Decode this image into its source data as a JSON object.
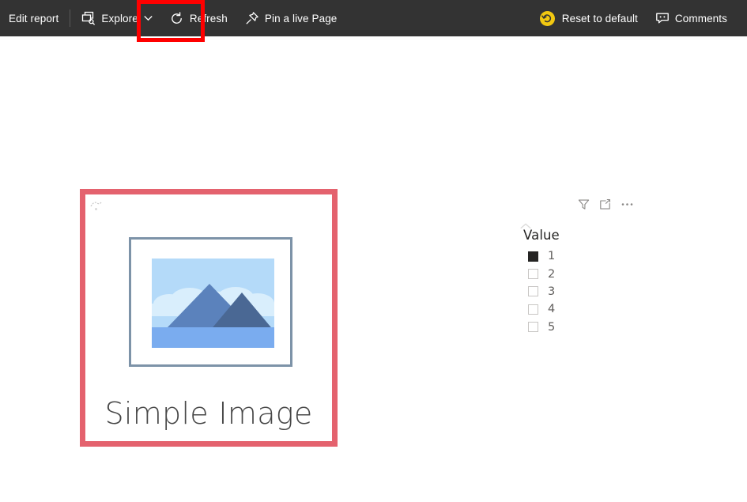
{
  "toolbar": {
    "background_color": "#333333",
    "left_items": [
      {
        "id": "edit-report",
        "label": "Edit report",
        "icon": "none"
      },
      {
        "id": "explore",
        "label": "Explore",
        "icon": "explore-icon",
        "has_chevron": true
      },
      {
        "id": "refresh",
        "label": "Refresh",
        "icon": "refresh-icon",
        "highlighted": true
      },
      {
        "id": "pin-live-page",
        "label": "Pin a live Page",
        "icon": "pin-icon"
      }
    ],
    "right_items": [
      {
        "id": "reset-to-default",
        "label": "Reset to default",
        "icon": "reset-icon",
        "icon_color": "#f2c811"
      },
      {
        "id": "comments",
        "label": "Comments",
        "icon": "comment-icon"
      }
    ]
  },
  "annotation": {
    "target": "Refresh",
    "color": "#ff0000",
    "shape": "rectangle"
  },
  "canvas": {
    "image_visual": {
      "caption": "Simple Image",
      "selected": true,
      "selection_color": "#e4626e",
      "picture": {
        "alt": "mountain-landscape",
        "frame_color": "#7d93a8",
        "sky_color": "#b4daf9",
        "cloud_color": "#d9eefc",
        "mountain_left_color": "#5b82bc",
        "mountain_right_color": "#4a6894",
        "water_color": "#7aacef"
      }
    },
    "slicer_visual": {
      "title": "Value",
      "header_icons": [
        {
          "id": "filter",
          "name": "filter-icon"
        },
        {
          "id": "focus-mode",
          "name": "focus-mode-icon"
        },
        {
          "id": "more-options",
          "name": "more-options-icon"
        }
      ],
      "items": [
        {
          "label": "1",
          "checked": true
        },
        {
          "label": "2",
          "checked": false
        },
        {
          "label": "3",
          "checked": false
        },
        {
          "label": "4",
          "checked": false
        },
        {
          "label": "5",
          "checked": false
        }
      ]
    }
  }
}
